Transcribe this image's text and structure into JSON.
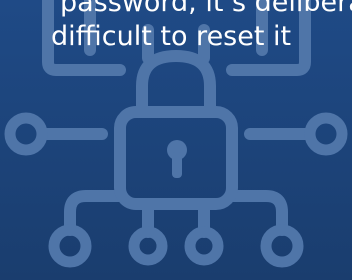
{
  "caption": {
    "line_1": "password, it’s deliberately",
    "line_2": "difficult to reset it"
  },
  "graphic": {
    "icon": "padlock-circuit-icon",
    "background_color": "#1f4a86",
    "line_color": "#4f75a8",
    "text_color": "#ffffff"
  }
}
